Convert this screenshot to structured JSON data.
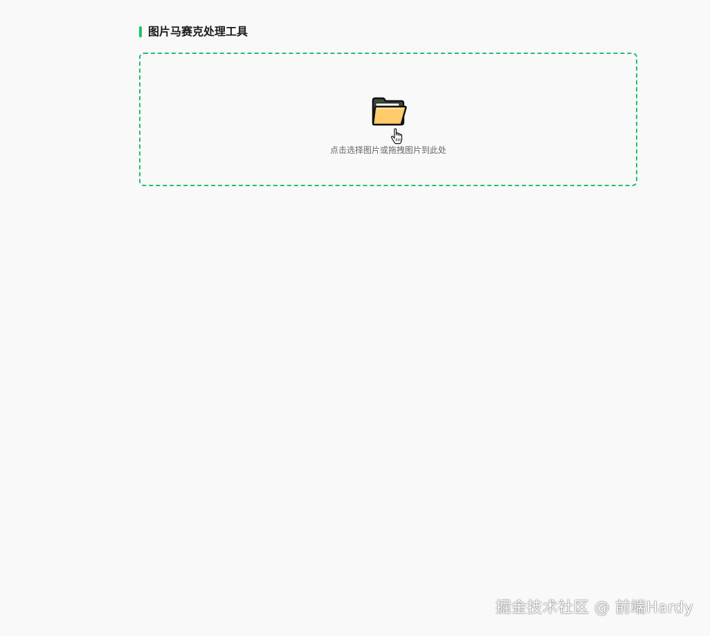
{
  "header": {
    "title": "图片马赛克处理工具",
    "accent_color": "#1ec26b"
  },
  "upload": {
    "hint": "点击选择图片或拖拽图片到此处",
    "icon": "folder-icon",
    "cursor": "hand-pointer-icon",
    "border_color": "#1ec26b"
  },
  "watermark": {
    "text": "掘金技术社区 @ 前端Hardy"
  }
}
